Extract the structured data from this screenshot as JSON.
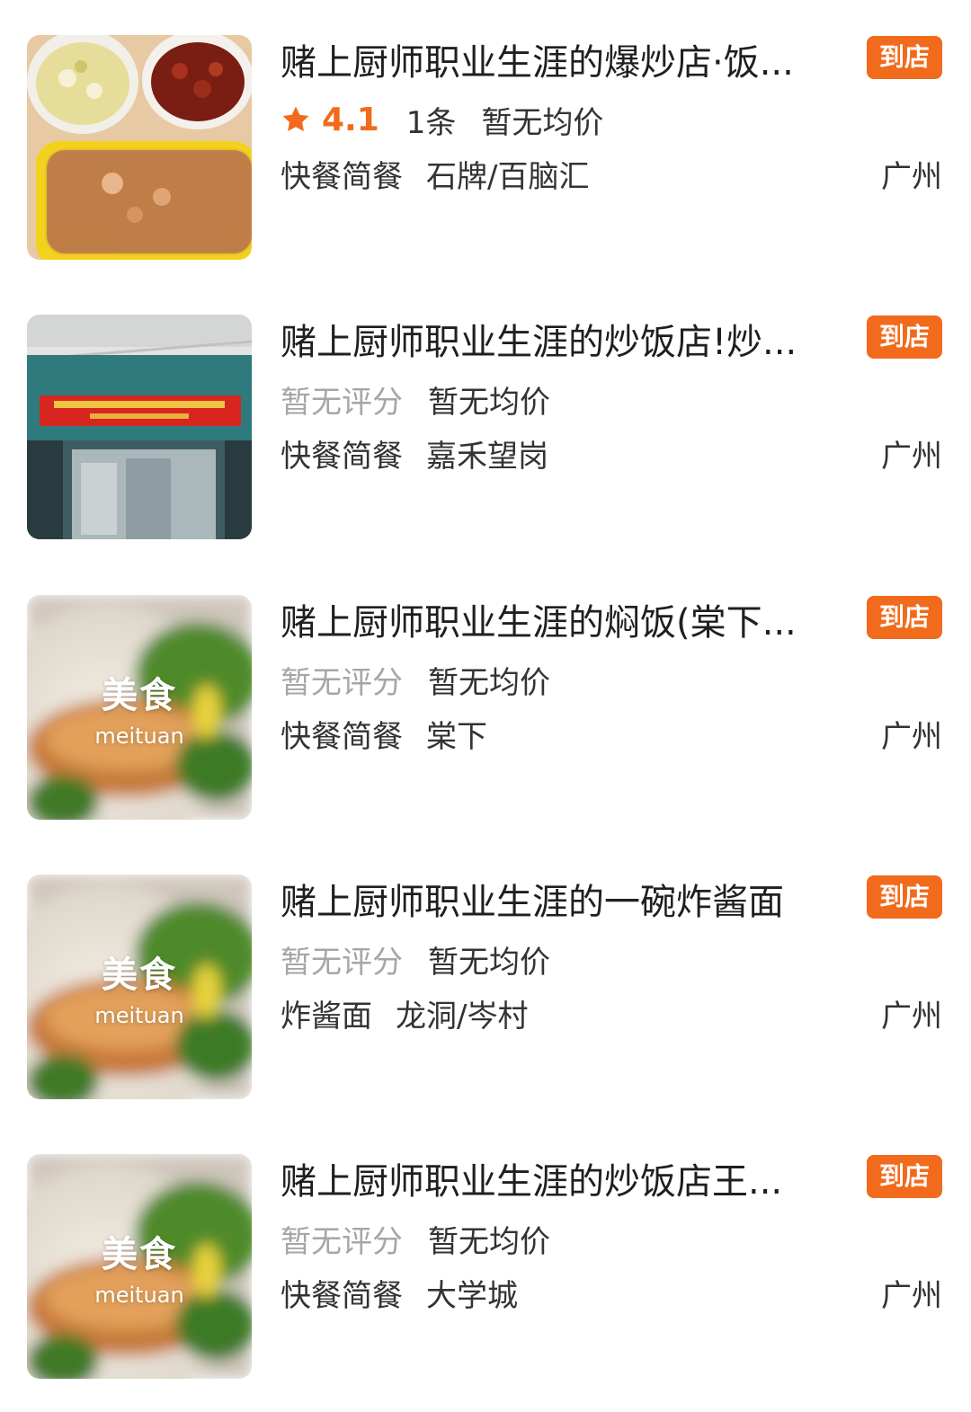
{
  "placeholder": {
    "title": "美食",
    "subtitle": "meituan"
  },
  "colors": {
    "accent": "#f26a1b",
    "muted": "#a6a6a6",
    "text": "#1f1f1f"
  },
  "items": [
    {
      "title": "赌上厨师职业生涯的爆炒店·饭...",
      "badge": "到店",
      "rating": "4.1",
      "reviews": "1条",
      "avg_price": "暂无均价",
      "category": "快餐简餐",
      "area": "石牌/百脑汇",
      "city": "广州",
      "image": "food-photo-bowls"
    },
    {
      "title": "赌上厨师职业生涯的炒饭店!炒...",
      "badge": "到店",
      "no_score": "暂无评分",
      "avg_price": "暂无均价",
      "category": "快餐简餐",
      "area": "嘉禾望岗",
      "city": "广州",
      "image": "storefront-photo"
    },
    {
      "title": "赌上厨师职业生涯的焖饭(棠下...",
      "badge": "到店",
      "no_score": "暂无评分",
      "avg_price": "暂无均价",
      "category": "快餐简餐",
      "area": "棠下",
      "city": "广州",
      "image": "meituan-placeholder"
    },
    {
      "title": "赌上厨师职业生涯的一碗炸酱面",
      "badge": "到店",
      "no_score": "暂无评分",
      "avg_price": "暂无均价",
      "category": "炸酱面",
      "area": "龙洞/岑村",
      "city": "广州",
      "image": "meituan-placeholder"
    },
    {
      "title": "赌上厨师职业生涯的炒饭店王...",
      "badge": "到店",
      "no_score": "暂无评分",
      "avg_price": "暂无均价",
      "category": "快餐简餐",
      "area": "大学城",
      "city": "广州",
      "image": "meituan-placeholder"
    }
  ]
}
